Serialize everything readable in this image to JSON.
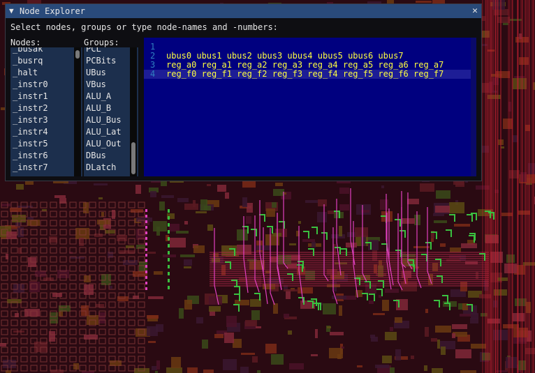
{
  "window": {
    "title": "Node Explorer",
    "collapse_glyph": "▼",
    "close_glyph": "✕"
  },
  "prompt": "Select nodes, groups or type node-names and -numbers:",
  "nodes": {
    "header": "Nodes:",
    "items": [
      "_busak",
      "_busrq",
      "_halt",
      "_instr0",
      "_instr1",
      "_instr2",
      "_instr3",
      "_instr4",
      "_instr5",
      "_instr6",
      "_instr7"
    ]
  },
  "groups": {
    "header": "Groups:",
    "items": [
      "PCL",
      "PCBits",
      "UBus",
      "VBus",
      "ALU_A",
      "ALU_B",
      "ALU_Bus",
      "ALU_Lat",
      "ALU_Out",
      "DBus",
      "DLatch"
    ]
  },
  "editor": {
    "lines": [
      {
        "num": "1",
        "text": ""
      },
      {
        "num": "2",
        "text": "ubus0 ubus1 ubus2 ubus3 ubus4 ubus5 ubus6 ubus7"
      },
      {
        "num": "3",
        "text": "reg_a0 reg_a1 reg_a2 reg_a3 reg_a4 reg_a5 reg_a6 reg_a7"
      },
      {
        "num": "4",
        "text": "reg_f0 reg_f1 reg_f2 reg_f3 reg_f4 reg_f5 reg_f6 reg_f7"
      }
    ],
    "current_line": "4"
  },
  "colors": {
    "title_bg": "#294a7a",
    "list_bg": "#1c2f4d",
    "editor_bg": "#00007f",
    "editor_text": "#ffff40",
    "line_number": "#2f7fbf"
  }
}
